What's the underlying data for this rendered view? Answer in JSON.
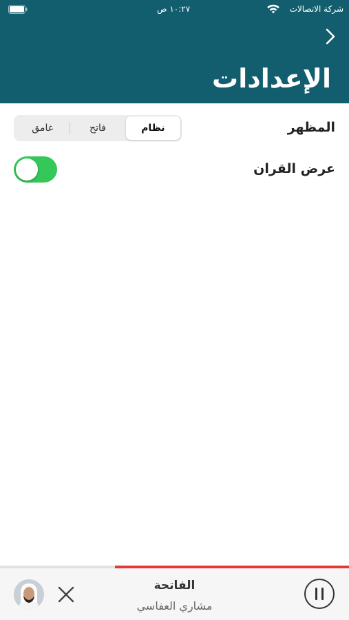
{
  "status_bar": {
    "carrier": "شركة الاتصالات",
    "time": "١٠:٢٧ ص"
  },
  "header": {
    "back_icon": "chevron-right-icon",
    "title": "الإعدادات"
  },
  "settings": {
    "appearance": {
      "label": "المظهر",
      "options": [
        "نظام",
        "فاتح",
        "غامق"
      ],
      "selected": "نظام"
    },
    "quran_display": {
      "label": "عرض القران",
      "enabled": true
    }
  },
  "player": {
    "title": "الفاتحة",
    "artist": "مشاري العفاسي",
    "progress": 0.67,
    "pause_icon": "pause-icon",
    "close_icon": "close-icon",
    "avatar_icon": "reciter-avatar"
  },
  "colors": {
    "header_bg": "#135e6e",
    "toggle_on": "#34c759",
    "progress": "#e53935"
  }
}
